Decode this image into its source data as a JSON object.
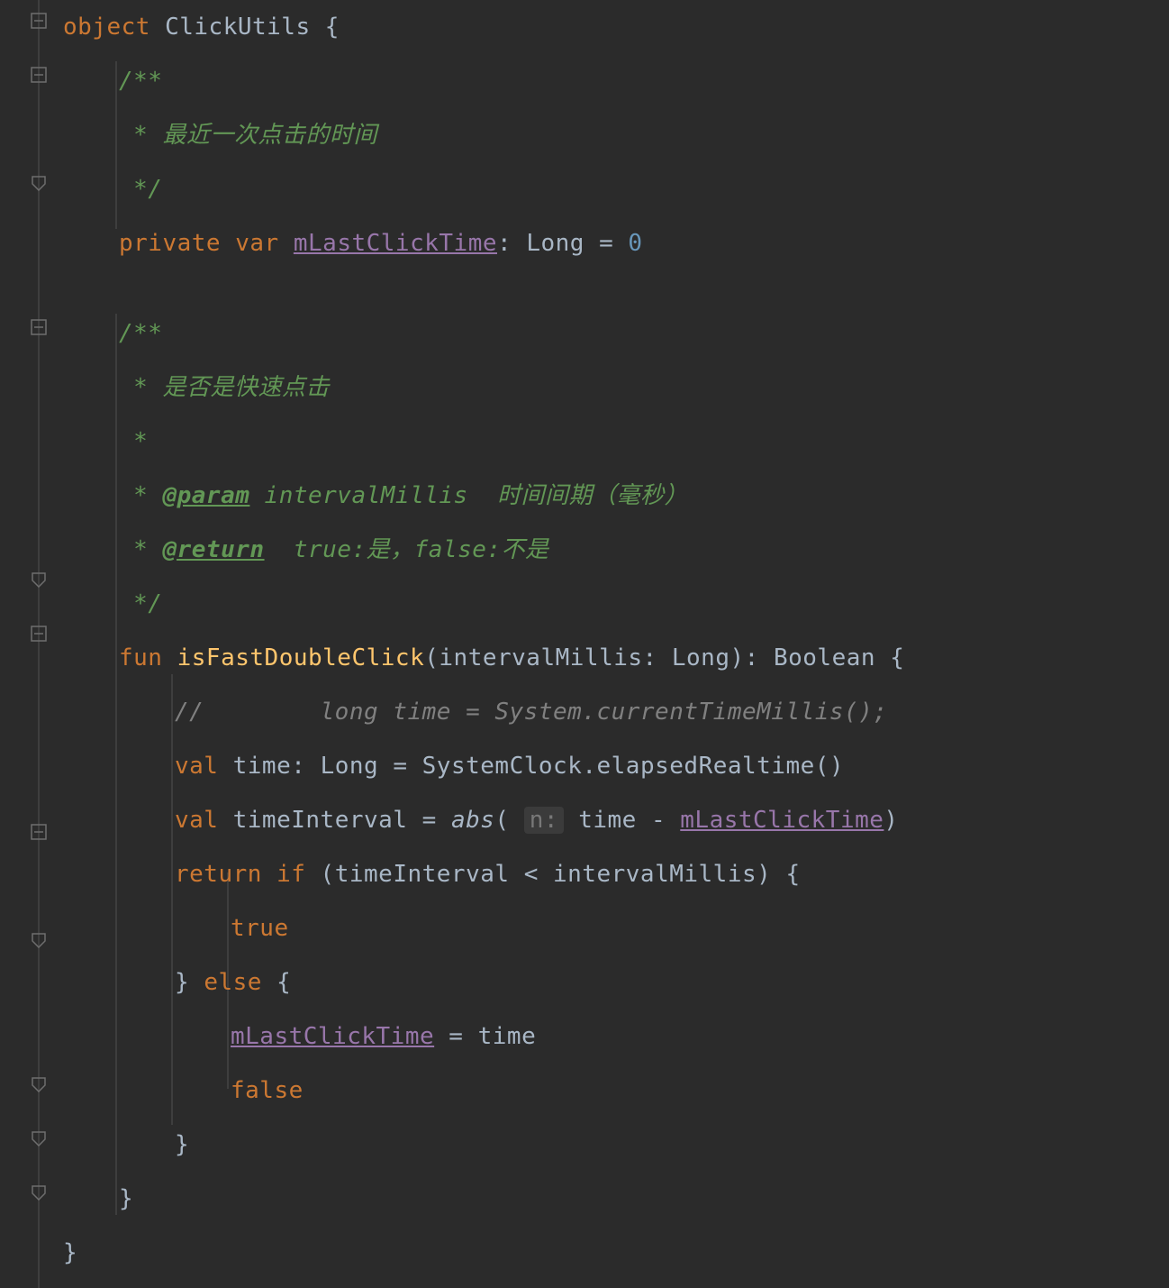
{
  "code": {
    "l1": {
      "kw": "object",
      "cls": "ClickUtils",
      "brace": "{"
    },
    "l2": {
      "c": "/**"
    },
    "l3": {
      "c": " * 最近一次点击的时间"
    },
    "l4": {
      "c": " */"
    },
    "l5": {
      "kw1": "private",
      "kw2": "var",
      "name": "mLastClickTime",
      "colon": ":",
      "type": "Long",
      "eq": "=",
      "val": "0"
    },
    "l7": {
      "c": "/**"
    },
    "l8": {
      "c": " * 是否是快速点击"
    },
    "l9": {
      "c": " *"
    },
    "l10": {
      "pre": " * ",
      "tag": "@param",
      "rest": " intervalMillis  时间间期（毫秒）"
    },
    "l11": {
      "pre": " * ",
      "tag": "@return",
      "rest": "  true:是，false:不是"
    },
    "l12": {
      "c": " */"
    },
    "l13": {
      "kw": "fun",
      "name": "isFastDoubleClick",
      "paren": "(",
      "param": "intervalMillis",
      "colon": ":",
      "ptype": "Long",
      "cparen": ")",
      "colon2": ":",
      "ret": "Boolean",
      "brace": "{"
    },
    "l14": {
      "c": "//        long time = System.currentTimeMillis();"
    },
    "l15": {
      "kw": "val",
      "name": "time",
      "colon": ":",
      "type": "Long",
      "eq": "=",
      "expr": "SystemClock.elapsedRealtime()"
    },
    "l16": {
      "kw": "val",
      "name": "timeInterval",
      "eq": "=",
      "fn": "abs",
      "hint": "n:",
      "mid": "time - ",
      "ref": "mLastClickTime",
      "cp": ")"
    },
    "l17": {
      "kw1": "return",
      "kw2": "if",
      "cond": "(timeInterval < intervalMillis) {"
    },
    "l18": {
      "v": "true"
    },
    "l19": {
      "cb": "}",
      "kw": "else",
      "ob": "{"
    },
    "l20": {
      "ref": "mLastClickTime",
      "rest": " = time"
    },
    "l21": {
      "v": "false"
    },
    "l22": {
      "c": "}"
    },
    "l23": {
      "c": "}"
    },
    "l24": {
      "c": "}"
    }
  }
}
